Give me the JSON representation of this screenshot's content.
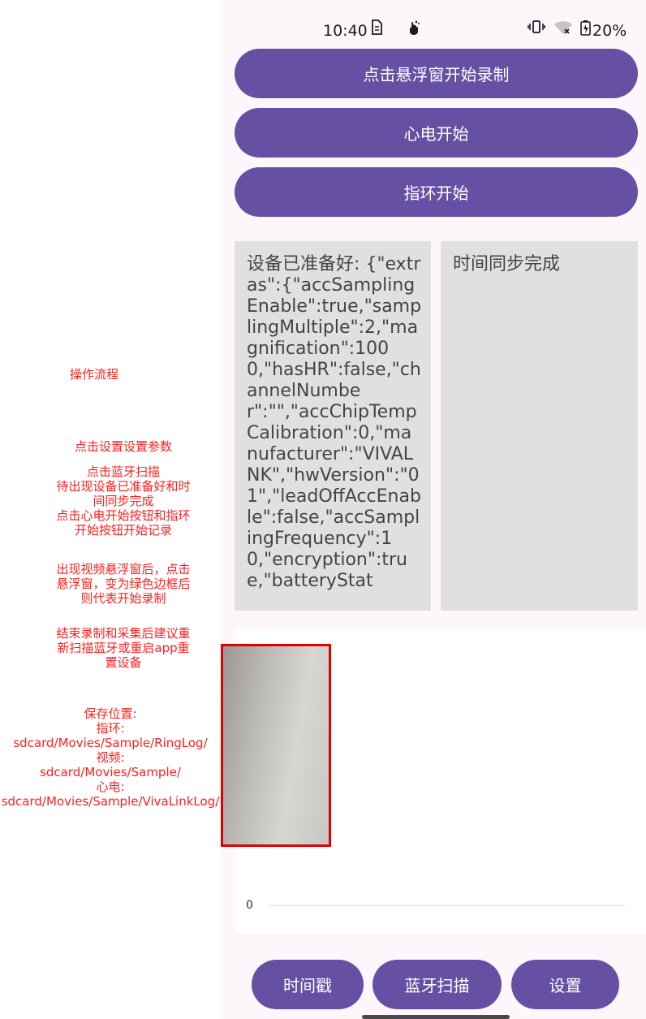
{
  "notes": {
    "title": "操作流程",
    "step_settings": "点击设置设置参数",
    "step_scan": "点击蓝牙扫描\n待出现设备已准备好和时\n间同步完成\n点击心电开始按钮和指环\n开始按钮开始记录",
    "step_float": "出现视频悬浮窗后，点击\n悬浮窗，变为绿色边框后\n则代表开始录制",
    "step_end": "结束录制和采集后建议重\n新扫描蓝牙或重启app重\n置设备",
    "save_location": "保存位置:\n指环:\nsdcard/Movies/Sample/RingLog/\n视频:\nsdcard/Movies/Sample/\n心电:\nsdcard/Movies/Sample/VivaLinkLog/"
  },
  "status_bar": {
    "time": "10:40",
    "battery": "20%"
  },
  "buttons": {
    "float_record": "点击悬浮窗开始录制",
    "ecg_start": "心电开始",
    "ring_start": "指环开始",
    "timestamp": "时间戳",
    "bluetooth_scan": "蓝牙扫描",
    "settings": "设置"
  },
  "info": {
    "device_status": "设备已准备好: {\"extras\":{\"accSamplingEnable\":true,\"samplingMultiple\":2,\"magnification\":1000,\"hasHR\":false,\"channelNumber\":\"\",\"accChipTempCalibration\":0,\"manufacturer\":\"VIVALNK\",\"hwVersion\":\"01\",\"leadOffAccEnable\":false,\"accSamplingFrequency\":10,\"encryption\":true,\"batteryStat",
    "time_sync": "时间同步完成"
  },
  "chart": {
    "zero_label": "0"
  },
  "colors": {
    "primary": "#6650a4",
    "note_red": "#ff1f1f",
    "info_bg": "#e0e0e0",
    "preview_border": "#e00000"
  },
  "icons": [
    "sim-icon",
    "gesture-icon",
    "vibrate-icon",
    "wifi-off-icon",
    "battery-icon"
  ]
}
